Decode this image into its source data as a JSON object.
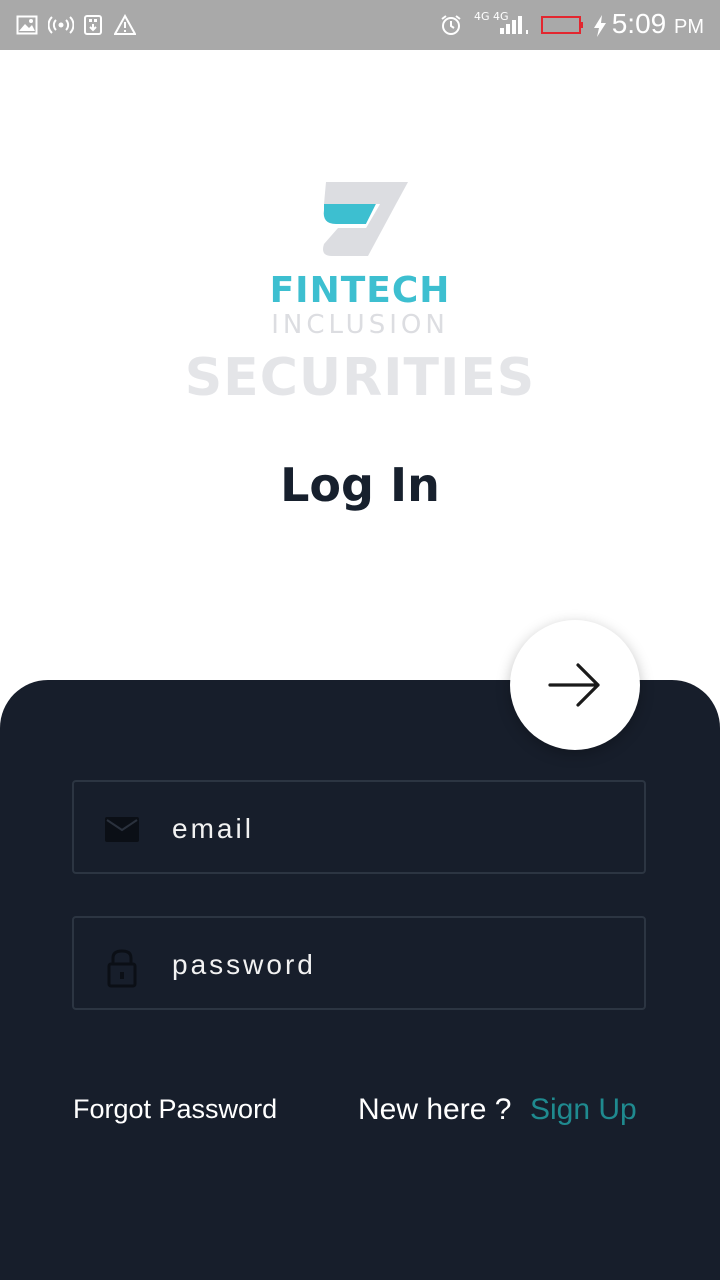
{
  "status_bar": {
    "time": "5:09",
    "ampm": "PM",
    "network_label": "4G 4G",
    "icons": [
      "image-icon",
      "hotspot-icon",
      "usb-icon",
      "warning-icon",
      "alarm-icon",
      "signal-icon",
      "battery-icon",
      "charging-icon"
    ]
  },
  "brand": {
    "name_main": "FINTECH",
    "name_sub": "INCLUSION",
    "name_secondary": "SECURITIES",
    "colors": {
      "accent": "#3dbfd0",
      "muted": "#dcdde1"
    }
  },
  "page": {
    "title": "Log In"
  },
  "form": {
    "email_placeholder": "email",
    "email_value": "",
    "password_placeholder": "password",
    "password_value": "",
    "submit_icon": "arrow-right-icon"
  },
  "footer": {
    "forgot_label": "Forgot Password",
    "new_here_label": "New here ?",
    "signup_label": "Sign Up",
    "signup_color": "#1f8a8f"
  },
  "theme": {
    "panel_bg": "#171e2b",
    "title_color": "#17202d"
  }
}
